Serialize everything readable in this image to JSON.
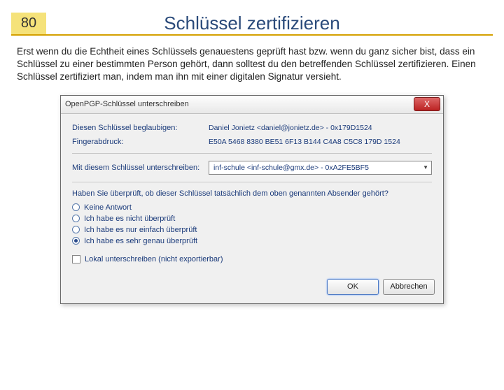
{
  "slide": {
    "number": "80",
    "title": "Schlüssel zertifizieren",
    "body": "Erst wenn du die Echtheit eines Schlüssels genauestens geprüft hast bzw. wenn du ganz sicher bist, dass ein Schlüssel zu einer bestimmten Person gehört, dann solltest du den betreffenden Schlüssel zertifizieren. Einen Schlüssel zertifiziert man, indem man ihn mit einer digitalen Signatur versieht."
  },
  "dialog": {
    "title": "OpenPGP-Schlüssel unterschreiben",
    "close": "X",
    "fields": {
      "certify_label": "Diesen Schlüssel beglaubigen:",
      "certify_value": "Daniel Jonietz <daniel@jonietz.de> - 0x179D1524",
      "fingerprint_label": "Fingerabdruck:",
      "fingerprint_value": "E50A 5468 8380 BE51 6F13 B144 C4A8 C5C8 179D 1524",
      "signwith_label": "Mit diesem Schlüssel unterschreiben:",
      "signwith_value": "inf-schule <inf-schule@gmx.de> - 0xA2FE5BF5"
    },
    "question": "Haben Sie überprüft, ob dieser Schlüssel tatsächlich dem oben genannten Absender gehört?",
    "radios": {
      "r0": "Keine Antwort",
      "r1": "Ich habe es nicht überprüft",
      "r2": "Ich habe es nur einfach überprüft",
      "r3": "Ich habe es sehr genau überprüft"
    },
    "checkbox_label": "Lokal unterschreiben (nicht exportierbar)",
    "buttons": {
      "ok": "OK",
      "cancel": "Abbrechen"
    }
  }
}
